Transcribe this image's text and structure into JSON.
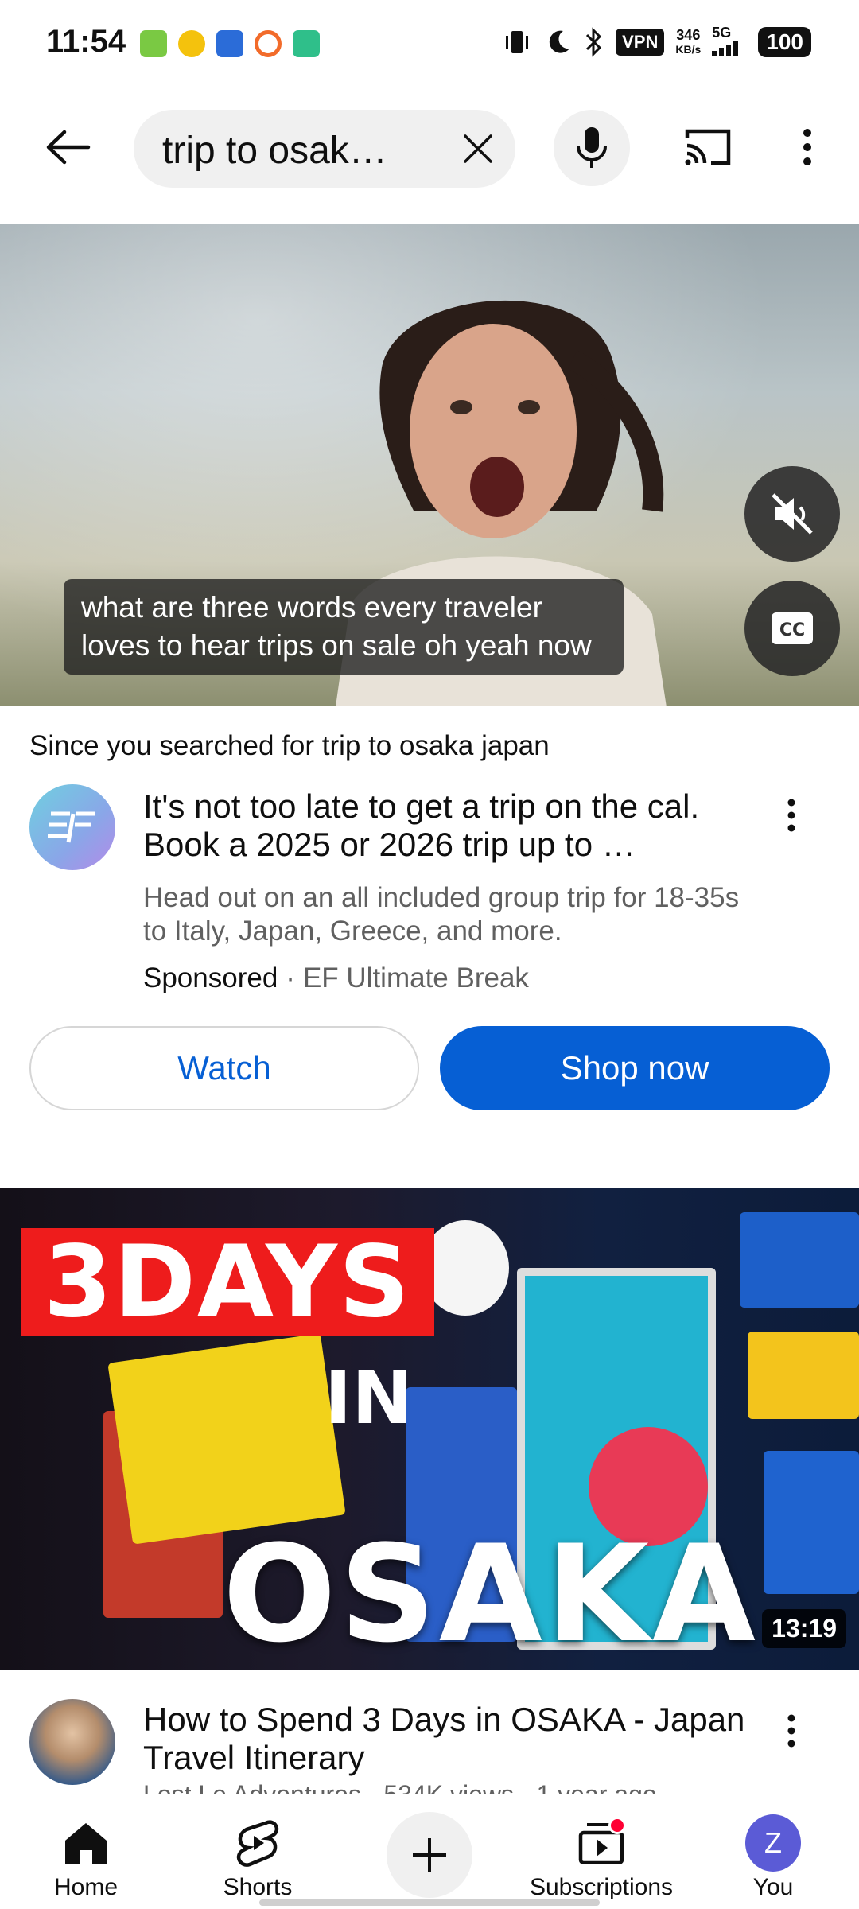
{
  "status_bar": {
    "time": "11:54",
    "vpn": "VPN",
    "speed_value": "346",
    "speed_unit": "KB/s",
    "network": "5G",
    "battery": "100"
  },
  "search": {
    "query": "trip to osak…"
  },
  "ad": {
    "caption": "what are three words every traveler loves to hear trips on sale oh yeah now",
    "since_prefix": "Since you searched for ",
    "since_query": "trip to osaka japan",
    "title": "It's not too late to get a trip on the cal. Book a 2025 or 2026 trip up to …",
    "description": "Head out on an all included group trip for 18-35s to Italy, Japan, Greece, and more.",
    "sponsored": "Sponsored",
    "separator": "·",
    "advertiser": "EF Ultimate Break",
    "watch_label": "Watch",
    "shop_label": "Shop now"
  },
  "video": {
    "thumb_days": "3DAYS",
    "thumb_in": "IN",
    "thumb_osaka": "OSAKA",
    "duration": "13:19",
    "title": "How to Spend 3 Days in OSAKA - Japan Travel Itinerary",
    "meta": "Lost Le Adventures · 534K views · 1 year ago"
  },
  "nav": {
    "home": "Home",
    "shorts": "Shorts",
    "subscriptions": "Subscriptions",
    "you": "You",
    "you_initial": "Z"
  },
  "colors": {
    "accent_blue": "#065fd4",
    "red": "#ff0033",
    "avatar_purple": "#5b5bd6"
  }
}
